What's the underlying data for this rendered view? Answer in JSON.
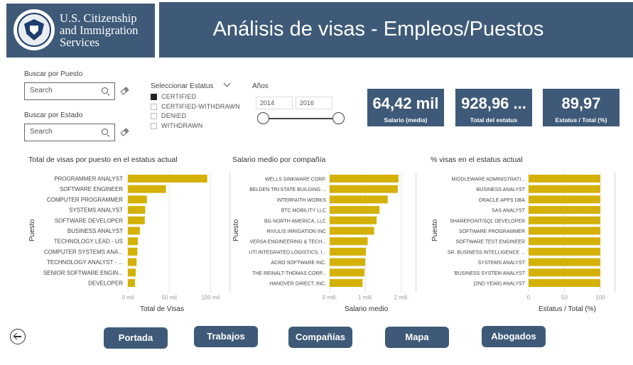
{
  "brand": {
    "logo_line1": "U.S. Citizenship",
    "logo_line2": "and Immigration",
    "logo_line3": "Services",
    "primary_color": "#3e5a78",
    "bar_color": "#d4b106"
  },
  "header": {
    "title": "Análisis de visas - Empleos/Puestos"
  },
  "filters": {
    "job_label": "Buscar por Puesto",
    "job_placeholder": "Search",
    "state_label": "Buscar por Estado",
    "state_placeholder": "Search",
    "status_title": "Seleccionar Estatus",
    "status_options": [
      {
        "label": "CERTIFIED",
        "checked": true
      },
      {
        "label": "CERTIFIED-WITHDRAWN",
        "checked": false
      },
      {
        "label": "DENIED",
        "checked": false
      },
      {
        "label": "WITHDRAWN",
        "checked": false
      }
    ],
    "years_label": "Años",
    "year_from": "2014",
    "year_to": "2016"
  },
  "kpis": [
    {
      "value": "64,42 mil",
      "caption": "Salario (media)"
    },
    {
      "value": "928,96 ...",
      "caption": "Total del estatus"
    },
    {
      "value": "89,97",
      "caption": "Estatus / Total  (%)"
    }
  ],
  "charts": [
    {
      "title": "Total de visas por puesto en el estatus actual",
      "xlabel": "Total de Visas",
      "ylabel": "Puesto",
      "ticks": [
        "0 mil",
        "50 mil",
        "100 mil"
      ]
    },
    {
      "title": "Salario medio por compañía",
      "xlabel": "Salario medio",
      "ylabel": "Puesto",
      "ticks": [
        "0 mill.",
        "1 mill.",
        "2 mill."
      ]
    },
    {
      "title": "% visas en el estatus actual",
      "xlabel": "Estatus / Total (%)",
      "ylabel": "Puesto",
      "ticks": [
        "0",
        "50",
        "100"
      ]
    }
  ],
  "chart_data": [
    {
      "type": "bar",
      "orientation": "horizontal",
      "categories": [
        "PROGRAMMER ANALYST",
        "SOFTWARE ENGINEER",
        "COMPUTER PROGRAMMER",
        "SYSTEMS ANALYST",
        "SOFTWARE DEVELOPER",
        "BUSINESS ANALYST",
        "TECHNOLOGY LEAD - US",
        "COMPUTER SYSTEMS ANA...",
        "TECHNOLOGY ANALYST - ...",
        "SENIOR SOFTWARE ENGIN...",
        "DEVELOPER"
      ],
      "values": [
        96000,
        46000,
        23000,
        21000,
        20500,
        14500,
        12000,
        11500,
        10500,
        9500,
        8500
      ],
      "xlim": [
        0,
        110000
      ]
    },
    {
      "type": "bar",
      "orientation": "horizontal",
      "categories": [
        "WELLS SINKWARE CORP.",
        "BELDEN TRI-STATE BUILDING ...",
        "INTERFAITH WORKS",
        "BTC MOBILITY LLC",
        "BG NORTH AMERICA, LLC",
        "RIVULIS IRRIGATION INC",
        "VERSA ENGINEERING & TECH...",
        "UTI INTEGRATED LOGISTICS, I...",
        "ACRO SOFTWARE INC.",
        "THE REINALT-THOMAS CORP...",
        "HANOVER DIRECT, INC."
      ],
      "values": [
        1920000,
        1900000,
        1620000,
        1390000,
        1310000,
        1240000,
        1060000,
        1010000,
        990000,
        970000,
        920000
      ],
      "xlim": [
        0,
        2100000
      ]
    },
    {
      "type": "bar",
      "orientation": "horizontal",
      "categories": [
        "MIDDLEWARE ADMINISTRATI...",
        "BUSINESS ANALYST",
        "ORACLE APPS DBA",
        "SAS ANALYST",
        "SHAREPOINT/SQL DEVELOPER",
        "SOFTWARE PROGRAMMER",
        "SOFTWARE TEST ENGINEER",
        "SR. BUSINESS INTELLIGENCE ...",
        "SYSTEMS ANALYST",
        "'BUSINESS SYSTEM ANALYST",
        "(2ND YEAR) ANALYST"
      ],
      "values": [
        100,
        100,
        100,
        100,
        100,
        100,
        100,
        100,
        100,
        100,
        100
      ],
      "xlim": [
        0,
        105
      ]
    }
  ],
  "nav": {
    "back_label": "back",
    "buttons": [
      "Portada",
      "Trabajos",
      "Compañías",
      "Mapa",
      "Abogados"
    ]
  }
}
